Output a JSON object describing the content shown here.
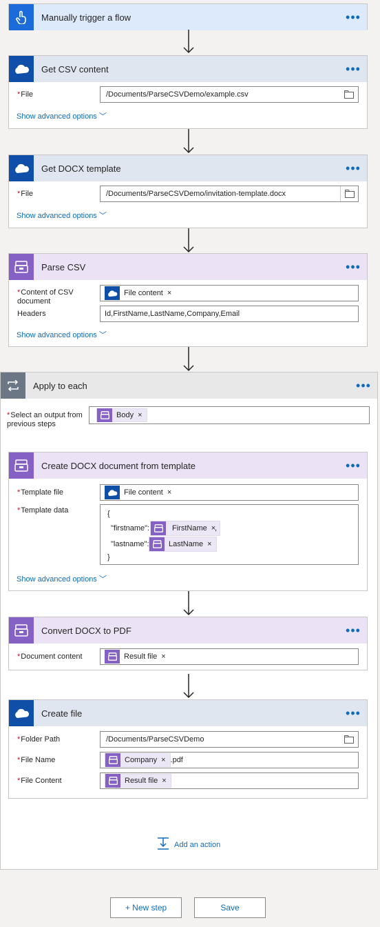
{
  "trigger": {
    "title": "Manually trigger a flow",
    "more": "•••"
  },
  "get_csv": {
    "title": "Get CSV content",
    "file_label": "File",
    "file_value": "/Documents/ParseCSVDemo/example.csv",
    "advanced": "Show advanced options"
  },
  "get_docx": {
    "title": "Get DOCX template",
    "file_label": "File",
    "file_value": "/Documents/ParseCSVDemo/invitation-template.docx",
    "advanced": "Show advanced options"
  },
  "parse_csv": {
    "title": "Parse CSV",
    "content_label": "Content of CSV document",
    "content_token": "File content",
    "headers_label": "Headers",
    "headers_value": "Id,FirstName,LastName,Company,Email",
    "advanced": "Show advanced options"
  },
  "apply": {
    "title": "Apply to each",
    "select_label": "Select an output from previous steps",
    "select_token": "Body"
  },
  "create_docx": {
    "title": "Create DOCX document from template",
    "template_file_label": "Template file",
    "template_file_token": "File content",
    "template_data_label": "Template data",
    "code": {
      "open": "{",
      "fn_key": "\"firstname\":",
      "fn_token": "FirstName",
      "fn_after": ",",
      "ln_key": "\"lastname\":",
      "ln_token": "LastName",
      "close": "}"
    },
    "advanced": "Show advanced options"
  },
  "convert": {
    "title": "Convert DOCX to PDF",
    "doc_label": "Document content",
    "doc_token": "Result file"
  },
  "create_file": {
    "title": "Create file",
    "folder_label": "Folder Path",
    "folder_value": "/Documents/ParseCSVDemo",
    "name_label": "File Name",
    "name_token": "Company",
    "name_suffix": ".pdf",
    "content_label": "File Content",
    "content_token": "Result file"
  },
  "add_action": "Add an action",
  "footer": {
    "new_step": "+ New step",
    "save": "Save"
  },
  "token_remove": "×",
  "required_mark": "*",
  "colors": {
    "accent": "#0f6cbd",
    "onedrive": "#0f4fa8",
    "encodian": "#8661c5",
    "trigger": "#1b6bdb"
  }
}
